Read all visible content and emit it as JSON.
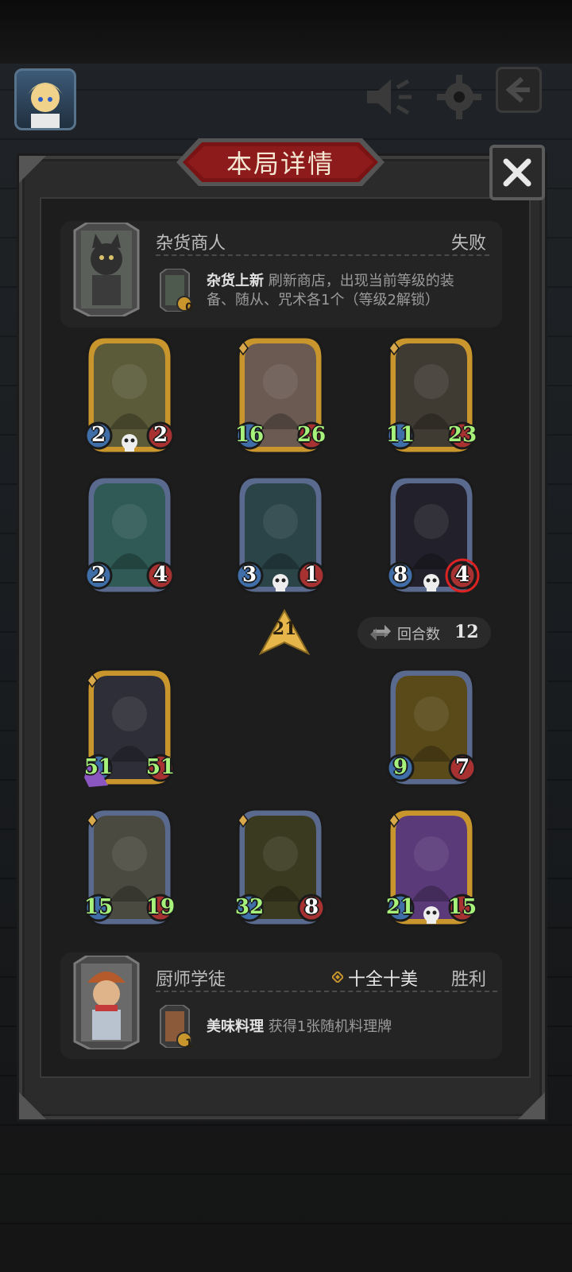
{
  "panel": {
    "title": "本局详情"
  },
  "opponent": {
    "name": "杂货商人",
    "result": "失败",
    "skill_title": "杂货上新",
    "skill_desc_line1": "刷新商店，出现当前等级的装",
    "skill_desc_line2": "备、随从、咒术各1个（等级2解锁）",
    "skill_cost": "0"
  },
  "enemy_cards": [
    {
      "atk": "2",
      "hp": "2"
    },
    {
      "atk": "16",
      "hp": "26"
    },
    {
      "atk": "11",
      "hp": "23"
    },
    {
      "atk": "2",
      "hp": "4"
    },
    {
      "atk": "3",
      "hp": "1"
    },
    {
      "atk": "8",
      "hp": "4"
    }
  ],
  "damage": "21",
  "rounds": {
    "label": "回合数",
    "value": "12"
  },
  "player_cards": [
    {
      "atk": "51",
      "hp": "51"
    },
    {
      "atk": "9",
      "hp": "7"
    },
    {
      "atk": "15",
      "hp": "19"
    },
    {
      "atk": "32",
      "hp": "8"
    },
    {
      "atk": "21",
      "hp": "15"
    }
  ],
  "player": {
    "name": "厨师学徒",
    "set_name": "十全十美",
    "result": "胜利",
    "skill_title": "美味料理",
    "skill_desc": "获得1张随机料理牌",
    "skill_cost": "1"
  },
  "colors": {
    "gold_frame": "#c9962e",
    "blue_frame": "#5a6a8f",
    "purple_frame": "#8a57c0",
    "stat_green": "#a6f27a"
  }
}
